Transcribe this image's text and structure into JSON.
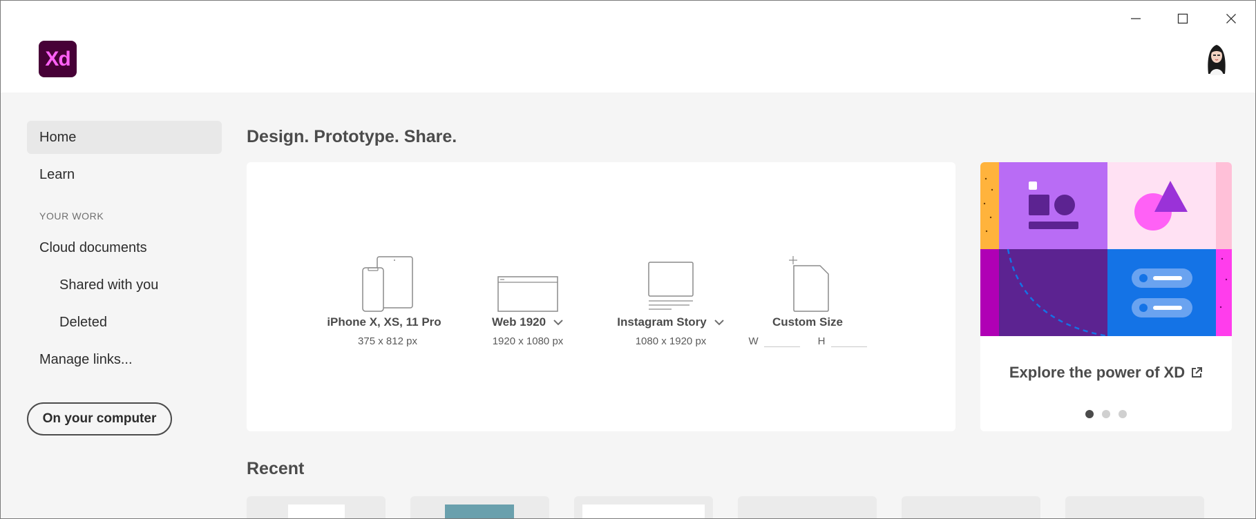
{
  "app": {
    "logo_text": "Xd",
    "brand_bg": "#470137",
    "brand_fg": "#ff61f6"
  },
  "window_controls": {
    "minimize_icon": "minimize-icon",
    "maximize_icon": "maximize-icon",
    "close_icon": "close-icon"
  },
  "sidebar": {
    "home": "Home",
    "learn": "Learn",
    "your_work_heading": "YOUR WORK",
    "cloud_documents": "Cloud documents",
    "shared_with_you": "Shared with you",
    "deleted": "Deleted",
    "manage_links": "Manage links...",
    "on_your_computer": "On your computer"
  },
  "main": {
    "headline": "Design. Prototype. Share.",
    "presets": [
      {
        "name": "iPhone X, XS, 11 Pro",
        "size": "375 x 812 px",
        "icon": "phone-tablet-icon"
      },
      {
        "name": "Web 1920",
        "size": "1920 x 1080 px",
        "icon": "browser-window-icon"
      },
      {
        "name": "Instagram Story",
        "size": "1080 x 1920 px",
        "icon": "social-post-icon"
      },
      {
        "name": "Custom Size",
        "icon": "custom-document-icon"
      }
    ],
    "custom_width_label": "W",
    "custom_height_label": "H",
    "explore_label": "Explore the power of XD",
    "carousel_dots": 3,
    "carousel_active": 1,
    "recent_title": "Recent"
  }
}
